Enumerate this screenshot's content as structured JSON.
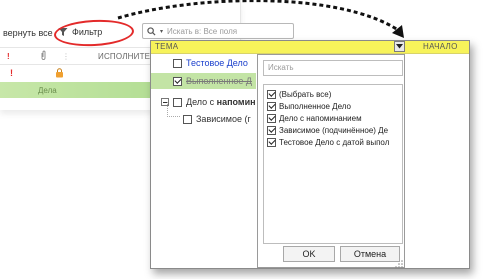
{
  "toolbar": {
    "expand_label": "вернуть все",
    "filter_label": "Фильтр",
    "search_placeholder": "Искать в: Все поля"
  },
  "grid": {
    "header_exclamation": "!",
    "header_lock_col": "",
    "header_executor": "ИСПОЛНИТЕЛ",
    "row1_flag": "!",
    "row2_text": "Дела"
  },
  "dialog": {
    "col_theme": "ТЕМА",
    "col_start": "НАЧАЛО",
    "tree": [
      {
        "label": "Тестовое Дело",
        "checked": false,
        "style": "blue"
      },
      {
        "label": "Выполненное Д",
        "checked": true,
        "style": "done"
      },
      {
        "label_prefix": "Дело с ",
        "label_bold": "напомин",
        "checked": false,
        "style": "normal"
      },
      {
        "label": "Зависимое (г",
        "checked": false,
        "style": "normal"
      }
    ]
  },
  "popup": {
    "search_placeholder": "Искать",
    "options": [
      {
        "label": "(Выбрать все)",
        "checked": true
      },
      {
        "label": "Выполненное Дело",
        "checked": true
      },
      {
        "label": "Дело с напоминанием",
        "checked": true
      },
      {
        "label": "Зависимое (подчинённое) Де",
        "checked": true
      },
      {
        "label": "Тестовое Дело с датой выпол",
        "checked": true
      }
    ],
    "ok_label": "OK",
    "cancel_label": "Отмена"
  },
  "colors": {
    "header_yellow": "#f7f35a",
    "done_green": "#c3e4a5",
    "highlight_red": "#e32a2a",
    "link_blue": "#1a3fcc"
  }
}
